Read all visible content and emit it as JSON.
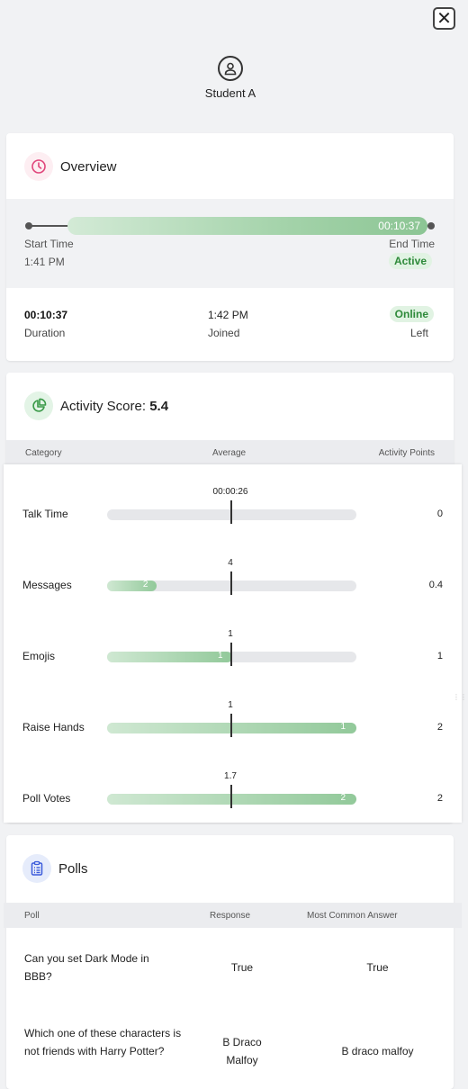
{
  "header": {
    "student_name": "Student A",
    "close_icon": "close-icon",
    "avatar_icon": "user-icon"
  },
  "overview": {
    "title": "Overview",
    "icon": "clock-icon",
    "timeline_value": "00:10:37",
    "start_label": "Start Time",
    "start_value": "1:41 PM",
    "end_label": "End Time",
    "end_value": "Active",
    "stats": [
      {
        "value": "00:10:37",
        "label": "Duration"
      },
      {
        "value": "1:42 PM",
        "label": "Joined"
      },
      {
        "value": "Online",
        "label": "Left"
      }
    ]
  },
  "activity": {
    "title": "Activity Score: ",
    "score": "5.4",
    "icon": "pie-chart-icon",
    "columns": [
      "Category",
      "Average",
      "Activity Points"
    ],
    "rows": [
      {
        "category": "Talk Time",
        "average": "00:00:26",
        "fill_fraction": 0,
        "fill_label": "",
        "points": "0"
      },
      {
        "category": "Messages",
        "average": "4",
        "fill_fraction": 0.2,
        "fill_label": "2",
        "points": "0.4"
      },
      {
        "category": "Emojis",
        "average": "1",
        "fill_fraction": 0.5,
        "fill_label": "1",
        "points": "1"
      },
      {
        "category": "Raise Hands",
        "average": "1",
        "fill_fraction": 1,
        "fill_label": "1",
        "points": "2"
      },
      {
        "category": "Poll Votes",
        "average": "1.7",
        "fill_fraction": 1,
        "fill_label": "2",
        "points": "2"
      }
    ]
  },
  "polls": {
    "title": "Polls",
    "icon": "clipboard-list-icon",
    "columns": [
      "Poll",
      "Response",
      "Most Common Answer"
    ],
    "rows": [
      {
        "poll": "Can you set Dark Mode in BBB?",
        "response": "True",
        "common": "True"
      },
      {
        "poll": "Which one of these characters is not friends with Harry Potter?",
        "response": "B Draco Malfoy",
        "common": "B draco malfoy"
      }
    ]
  },
  "colors": {
    "accent_green": "#2e8a3a",
    "bar_green": "#92c99a",
    "overview_icon": "#e0457b",
    "activity_icon": "#3a9a48",
    "polls_icon": "#3b5bdb"
  }
}
